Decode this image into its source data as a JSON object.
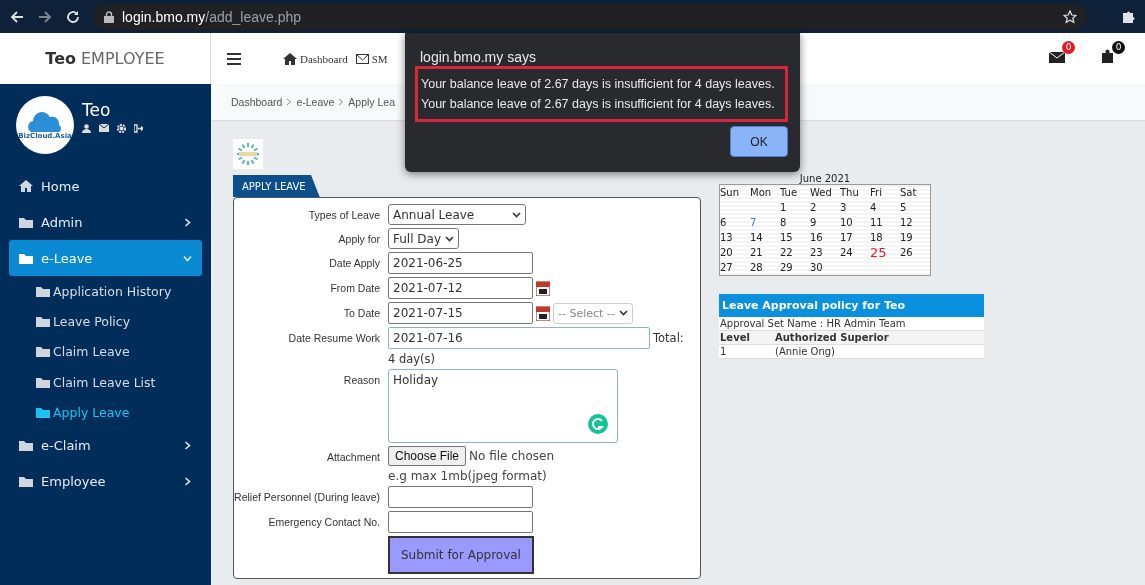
{
  "browser": {
    "url_host": "login.bmo.my",
    "url_path": "/add_leave.php"
  },
  "header": {
    "brand_name": "Teo",
    "brand_role": "EMPLOYEE",
    "nav": [
      {
        "label": "Dashboard"
      },
      {
        "label": "SM"
      }
    ],
    "badges": [
      {
        "count": "0"
      },
      {
        "count": "0"
      }
    ]
  },
  "profile": {
    "name": "Teo",
    "logo_text": "BizCloud.Asia"
  },
  "sidebar": {
    "items": [
      {
        "label": "Home",
        "selected": false
      },
      {
        "label": "Admin",
        "selected": false,
        "expanded": false
      },
      {
        "label": "e-Leave",
        "selected": true,
        "expanded": true,
        "children": [
          {
            "label": "Application History",
            "selected": false
          },
          {
            "label": "Leave Policy",
            "selected": false
          },
          {
            "label": "Claim Leave",
            "selected": false
          },
          {
            "label": "Claim Leave List",
            "selected": false
          },
          {
            "label": "Apply Leave",
            "selected": true
          }
        ]
      },
      {
        "label": "e-Claim",
        "selected": false,
        "expanded": false
      },
      {
        "label": "Employee",
        "selected": false,
        "expanded": false
      }
    ]
  },
  "breadcrumb": [
    "Dashboard",
    "e-Leave",
    "Apply Lea"
  ],
  "form": {
    "title": "APPLY LEAVE",
    "fields": [
      {
        "kind": "select",
        "label": "Types of Leave",
        "value": "Annual Leave"
      },
      {
        "kind": "select",
        "label": "Apply for",
        "value": "Full Day"
      },
      {
        "kind": "text",
        "label": "Date Apply",
        "value": "2021-06-25"
      },
      {
        "kind": "date",
        "label": "From Date",
        "value": "2021-07-12"
      },
      {
        "kind": "date",
        "label": "To Date",
        "value": "2021-07-15",
        "extra_select": "-- Select --"
      },
      {
        "kind": "wide",
        "label": "Date Resume Work",
        "value": "2021-07-16",
        "total": "Total:",
        "total_value": "4 day(s)"
      },
      {
        "kind": "textarea",
        "label": "Reason",
        "value": "Holiday"
      },
      {
        "kind": "file",
        "label": "Attachment",
        "button": "Choose File",
        "status": "No file chosen",
        "hint": "e.g max 1mb(jpeg format)"
      },
      {
        "kind": "text",
        "label": "Relief Personnel (During leave)"
      },
      {
        "kind": "text",
        "label": "Emergency Contact No."
      }
    ],
    "submit": "Submit for Approval"
  },
  "calendar": {
    "title": "June 2021",
    "weekdays": [
      "Sun",
      "Mon",
      "Tue",
      "Wed",
      "Thu",
      "Fri",
      "Sat"
    ],
    "weeks": [
      [
        "1",
        "2",
        "3",
        "4",
        "5"
      ],
      [
        "6",
        {
          "day": "7",
          "kind": "holiday"
        },
        "8",
        "9",
        "10",
        "11",
        "12"
      ],
      [
        "13",
        "14",
        "15",
        "16",
        "17",
        "18",
        "19"
      ],
      [
        "20",
        "21",
        "22",
        "23",
        "24",
        {
          "day": "25",
          "kind": "today"
        },
        "26"
      ],
      [
        "27",
        "28",
        "29",
        "30"
      ]
    ]
  },
  "policy": {
    "title": "Leave Approval policy for Teo",
    "set_name": "Approval Set Name : HR Admin Team",
    "columns": [
      "Level",
      "Authorized Superior"
    ],
    "rows": [
      [
        "1",
        "(Annie Ong)"
      ]
    ]
  },
  "dialog": {
    "title": "login.bmo.my says",
    "message": "Your balance leave of 2.67 days is insufficient for 4 days leaves. Your balance leave of 2.67 days is insufficient for 4 days leaves.",
    "button": "OK"
  }
}
